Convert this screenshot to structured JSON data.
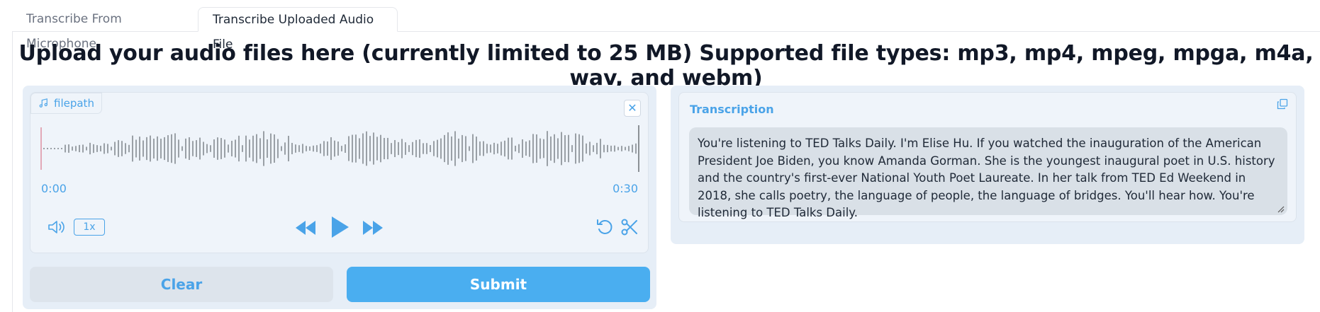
{
  "tabs": [
    {
      "label": "Transcribe From Microphone",
      "active": false
    },
    {
      "label": "Transcribe Uploaded Audio File",
      "active": true
    }
  ],
  "headline": "Upload your audio files here (currently limited to 25 MB) Supported file types: mp3, mp4, mpeg, mpga, m4a, wav, and webm)",
  "audio": {
    "label": "filepath",
    "label_icon": "music-note-icon",
    "current_time": "0:00",
    "duration": "0:30",
    "playback_rate": "1x",
    "icons": [
      "volume-icon",
      "rewind-icon",
      "play-icon",
      "fast-forward-icon",
      "reset-icon",
      "trim-icon",
      "close-icon"
    ]
  },
  "buttons": {
    "clear": "Clear",
    "submit": "Submit"
  },
  "transcription": {
    "label": "Transcription",
    "text": "You're listening to TED Talks Daily. I'm Elise Hu. If you watched the inauguration of the American President Joe Biden, you know Amanda Gorman. She is the youngest inaugural poet in U.S. history and the country's first-ever National Youth Poet Laureate. In her talk from TED Ed Weekend in 2018, she calls poetry, the language of people, the language of bridges. You'll hear how. You're listening to TED Talks Daily."
  },
  "colors": {
    "accent": "#4aa3e8",
    "submit": "#4aaef0",
    "panel": "#e6eef7"
  }
}
